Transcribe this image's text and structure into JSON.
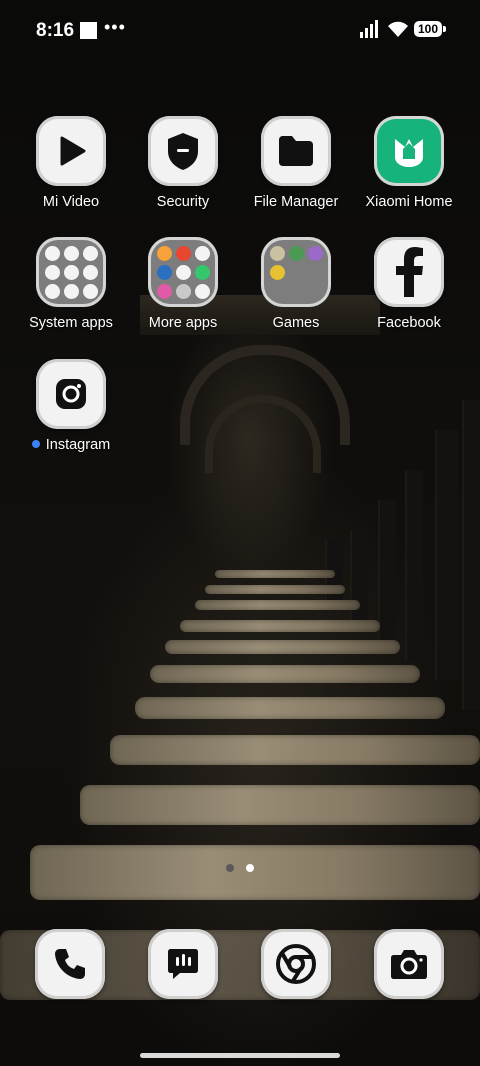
{
  "status_bar": {
    "time": "8:16",
    "battery": "100"
  },
  "apps": [
    {
      "name": "mi-video",
      "label": "Mi Video",
      "icon": "play-icon"
    },
    {
      "name": "security",
      "label": "Security",
      "icon": "shield-icon"
    },
    {
      "name": "file-manager",
      "label": "File Manager",
      "icon": "folder-icon"
    },
    {
      "name": "xiaomi-home",
      "label": "Xiaomi Home",
      "icon": "xiaomi-home-icon"
    },
    {
      "name": "system-apps",
      "label": "System apps",
      "icon": "folder-grid-icon"
    },
    {
      "name": "more-apps",
      "label": "More apps",
      "icon": "folder-grid-icon"
    },
    {
      "name": "games",
      "label": "Games",
      "icon": "folder-grid-icon"
    },
    {
      "name": "facebook",
      "label": "Facebook",
      "icon": "facebook-icon"
    },
    {
      "name": "instagram",
      "label": "Instagram",
      "icon": "instagram-icon"
    }
  ],
  "dock": [
    {
      "name": "phone",
      "icon": "phone-icon"
    },
    {
      "name": "messages",
      "icon": "message-icon"
    },
    {
      "name": "chrome",
      "icon": "chrome-icon"
    },
    {
      "name": "camera",
      "icon": "camera-icon"
    }
  ],
  "page_indicator": {
    "pages": 2,
    "current": 2
  },
  "colors": {
    "new_badge": "#3b82f6",
    "xiaomi_home_green": "#16b37a"
  }
}
